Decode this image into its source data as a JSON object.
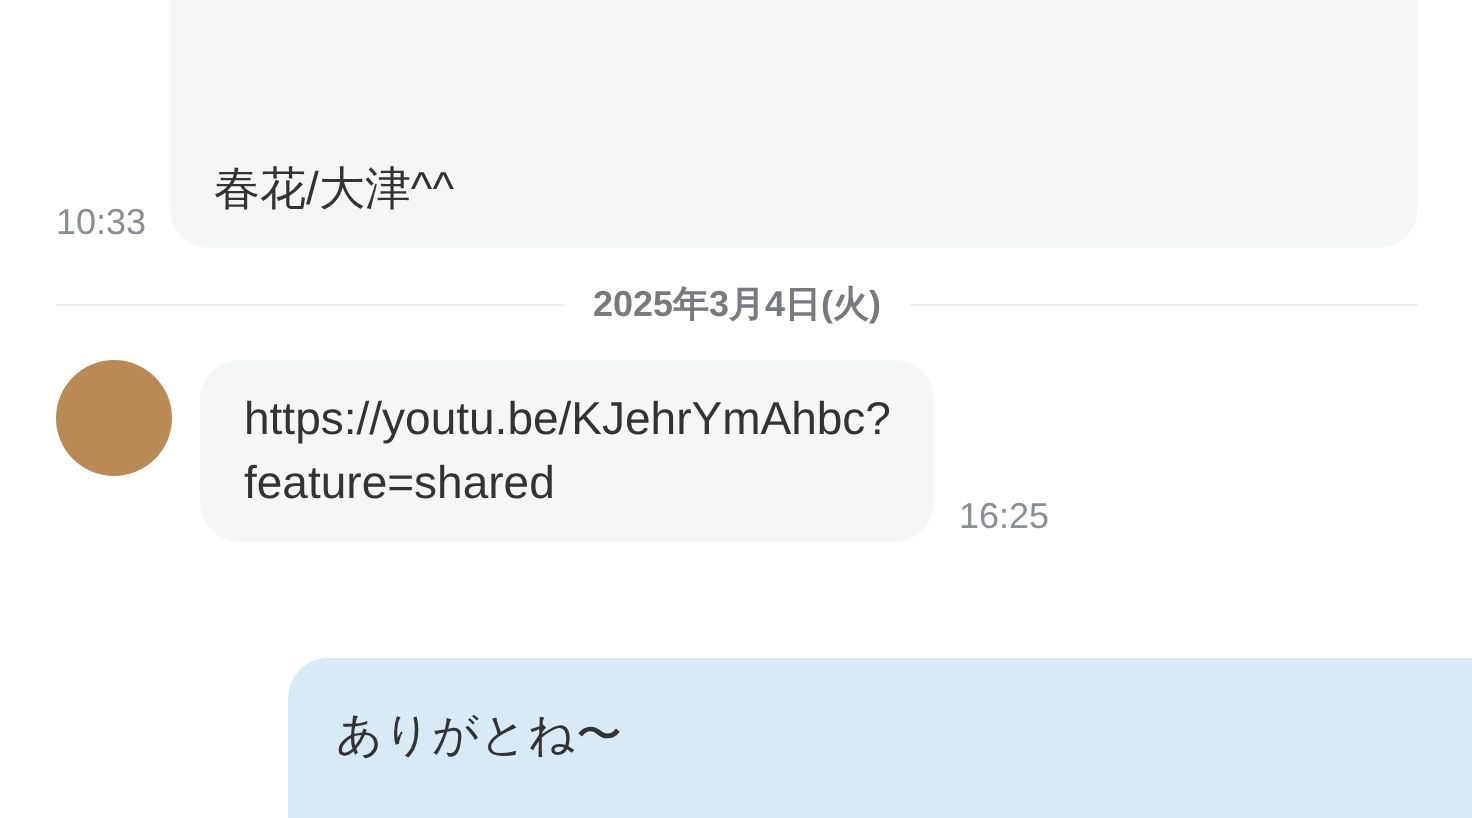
{
  "messages_before": [
    {
      "kind": "incoming_plain",
      "lines": [
        "春花/大津^^"
      ],
      "time": "10:33"
    }
  ],
  "date_divider": "2025年3月4日(火)",
  "messages": [
    {
      "kind": "incoming",
      "lines": [
        "https://youtu.be/KJehrYmAhbc?",
        "feature=shared"
      ],
      "time": "16:25"
    },
    {
      "kind": "outgoing",
      "lines": [
        "ありがとね〜"
      ]
    }
  ]
}
